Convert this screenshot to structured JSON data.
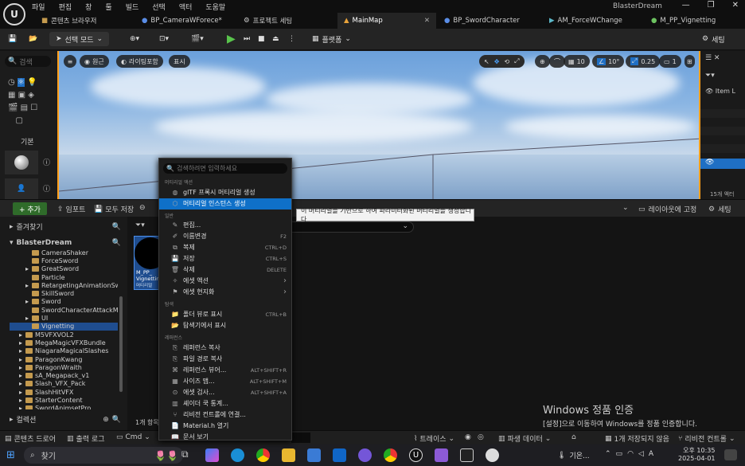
{
  "window": {
    "title": "BlasterDream",
    "menu": [
      "파일",
      "편집",
      "창",
      "툴",
      "빌드",
      "선택",
      "액터",
      "도움말"
    ],
    "controls": [
      "—",
      "❐",
      "✕"
    ]
  },
  "tabs": [
    {
      "label": "콘텐츠 브라우저",
      "icon": "folder-icon"
    },
    {
      "label": "BP_CameraWForece*",
      "icon": "blueprint-icon"
    },
    {
      "label": "프로젝트 세팅",
      "icon": "gear-icon"
    },
    {
      "label": "MainMap",
      "icon": "level-icon",
      "active": true
    },
    {
      "label": "BP_SwordCharacter",
      "icon": "blueprint-icon"
    },
    {
      "label": "AM_ForceWChange",
      "icon": "montage-icon"
    },
    {
      "label": "M_PP_Vignetting",
      "icon": "material-icon"
    }
  ],
  "toolbar": {
    "select_mode": "선택 모드",
    "platform": "플랫폼",
    "settings": "세팅"
  },
  "left_panel": {
    "search_placeholder": "검색",
    "basic_label": "기본"
  },
  "viewport": {
    "perspective": "원근",
    "lighting": "라이팅포함",
    "show": "표시",
    "grid_snap": "10",
    "rot_snap": "10°",
    "scale_snap": "0.25",
    "camera_speed": "1"
  },
  "outliner": {
    "item_label": "Item L",
    "count": "15개 액터"
  },
  "content_browser": {
    "add": "+ 추가",
    "import": "임포트",
    "save_all": "모두 저장",
    "layout_fix": "레이아웃에 고정",
    "settings": "세팅",
    "favorites": "즐겨찾기",
    "project": "BlasterDream",
    "collections": "컬렉션",
    "item_count": "1개 항목",
    "tree": [
      {
        "label": "CameraShaker",
        "depth": 2
      },
      {
        "label": "ForceSword",
        "depth": 2
      },
      {
        "label": "GreatSword",
        "depth": 2,
        "arrow": true
      },
      {
        "label": "Particle",
        "depth": 2
      },
      {
        "label": "RetargetingAnimationSwo",
        "depth": 2,
        "arrow": true
      },
      {
        "label": "SkillSword",
        "depth": 2
      },
      {
        "label": "Sword",
        "depth": 2,
        "arrow": true
      },
      {
        "label": "SwordCharacterAttackMo",
        "depth": 2
      },
      {
        "label": "UI",
        "depth": 2,
        "arrow": true
      },
      {
        "label": "Vignetting",
        "depth": 2,
        "selected": true
      },
      {
        "label": "M5VFXVOL2",
        "depth": 1,
        "arrow": true
      },
      {
        "label": "MegaMagicVFXBundle",
        "depth": 1,
        "arrow": true
      },
      {
        "label": "NiagaraMagicalSlashes",
        "depth": 1,
        "arrow": true
      },
      {
        "label": "ParagonKwang",
        "depth": 1,
        "arrow": true
      },
      {
        "label": "ParagonWraith",
        "depth": 1,
        "arrow": true
      },
      {
        "label": "sA_Megapack_v1",
        "depth": 1,
        "arrow": true
      },
      {
        "label": "Slash_VFX_Pack",
        "depth": 1,
        "arrow": true
      },
      {
        "label": "SlashHitVFX",
        "depth": 1,
        "arrow": true
      },
      {
        "label": "StarterContent",
        "depth": 1,
        "arrow": true
      },
      {
        "label": "SwordAnimsetPro",
        "depth": 1,
        "arrow": true
      }
    ],
    "asset": {
      "name": "M_PP_Vignetting",
      "short": "M_PP_",
      "sub": "Vignetting",
      "type": "머티리얼"
    }
  },
  "context_menu": {
    "search_placeholder": "검색하려면 입력하세요",
    "sections": [
      "머티리얼 액션",
      "일반",
      "탐색",
      "레퍼런스"
    ],
    "items": [
      {
        "label": "glTF 프록시 머티리얼 생성",
        "icon": "gltf-icon",
        "shortcut": ""
      },
      {
        "label": "머티리얼 인스턴스 생성",
        "icon": "material-instance-icon",
        "shortcut": "",
        "highlight": true
      },
      {
        "label": "편집...",
        "icon": "edit-icon",
        "shortcut": ""
      },
      {
        "label": "이름변경",
        "icon": "rename-icon",
        "shortcut": "F2"
      },
      {
        "label": "복제",
        "icon": "duplicate-icon",
        "shortcut": "CTRL+D"
      },
      {
        "label": "저장",
        "icon": "save-icon",
        "shortcut": "CTRL+S"
      },
      {
        "label": "삭제",
        "icon": "delete-icon",
        "shortcut": "DELETE"
      },
      {
        "label": "에셋 액션",
        "icon": "asset-actions-icon",
        "shortcut": "›"
      },
      {
        "label": "에셋 현지화",
        "icon": "localize-icon",
        "shortcut": "›"
      },
      {
        "label": "폴더 뷰로 표시",
        "icon": "folder-view-icon",
        "shortcut": "CTRL+B"
      },
      {
        "label": "탐색기에서 표시",
        "icon": "explorer-icon",
        "shortcut": ""
      },
      {
        "label": "레퍼런스 복사",
        "icon": "copy-reference-icon",
        "shortcut": ""
      },
      {
        "label": "파일 경로 복사",
        "icon": "copy-path-icon",
        "shortcut": ""
      },
      {
        "label": "레퍼런스 뷰어...",
        "icon": "reference-viewer-icon",
        "shortcut": "ALT+SHIFT+R"
      },
      {
        "label": "사이즈 맵...",
        "icon": "size-map-icon",
        "shortcut": "ALT+SHIFT+M"
      },
      {
        "label": "에셋 검사...",
        "icon": "audit-icon",
        "shortcut": "ALT+SHIFT+A"
      },
      {
        "label": "셰이더 쿡 통계...",
        "icon": "shader-stats-icon",
        "shortcut": ""
      },
      {
        "label": "리비전 컨트롤에 연결...",
        "icon": "source-control-icon",
        "shortcut": ""
      },
      {
        "label": "Material.h 열기",
        "icon": "open-header-icon",
        "shortcut": ""
      },
      {
        "label": "문서 보기",
        "icon": "docs-icon",
        "shortcut": ""
      }
    ]
  },
  "tooltip": "이 머티리얼을 기반으로 하여 파라미터화된 머티리얼을 생성합니다",
  "watermark": {
    "title": "Windows 정품 인증",
    "body": "[설정]으로 이동하여 Windows를 정품 인증합니다."
  },
  "statusbar": {
    "content_drawer": "콘텐츠 드로어",
    "output_log": "출력 로그",
    "cmd": "Cmd",
    "trace": "트레이스",
    "derived_data": "파생 데이터",
    "unsaved": "1개 저장되지 않음",
    "revision": "리비전 컨트롤"
  },
  "taskbar": {
    "search": "찾기",
    "weather": "기온...",
    "ime": "A",
    "time": "오후 10:35",
    "date": "2025-04-01"
  }
}
